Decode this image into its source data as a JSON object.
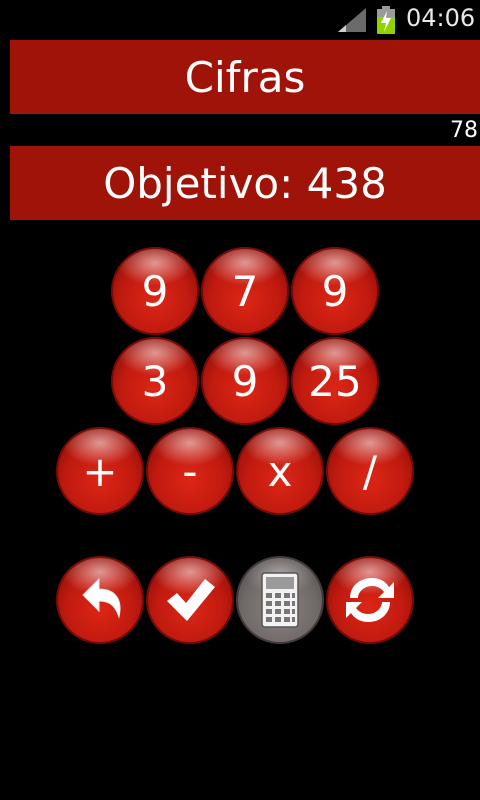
{
  "status_bar": {
    "time": "04:06",
    "signal_icon": "signal-icon",
    "battery_icon": "battery-charging-icon"
  },
  "title": "Cifras",
  "score": "78",
  "target": {
    "label": "Objetivo: 438"
  },
  "numbers": [
    "9",
    "7",
    "9",
    "3",
    "9",
    "25"
  ],
  "operators": [
    "+",
    "-",
    "x",
    "/"
  ],
  "actions": [
    {
      "name": "undo",
      "icon": "undo-arrow-icon"
    },
    {
      "name": "check",
      "icon": "checkmark-icon"
    },
    {
      "name": "calculator",
      "icon": "calculator-icon"
    },
    {
      "name": "refresh",
      "icon": "refresh-icon"
    }
  ],
  "colors": {
    "banner": "#a01309",
    "button_red": "#c01a0f",
    "button_gray": "#6f6866",
    "background": "#000000"
  }
}
